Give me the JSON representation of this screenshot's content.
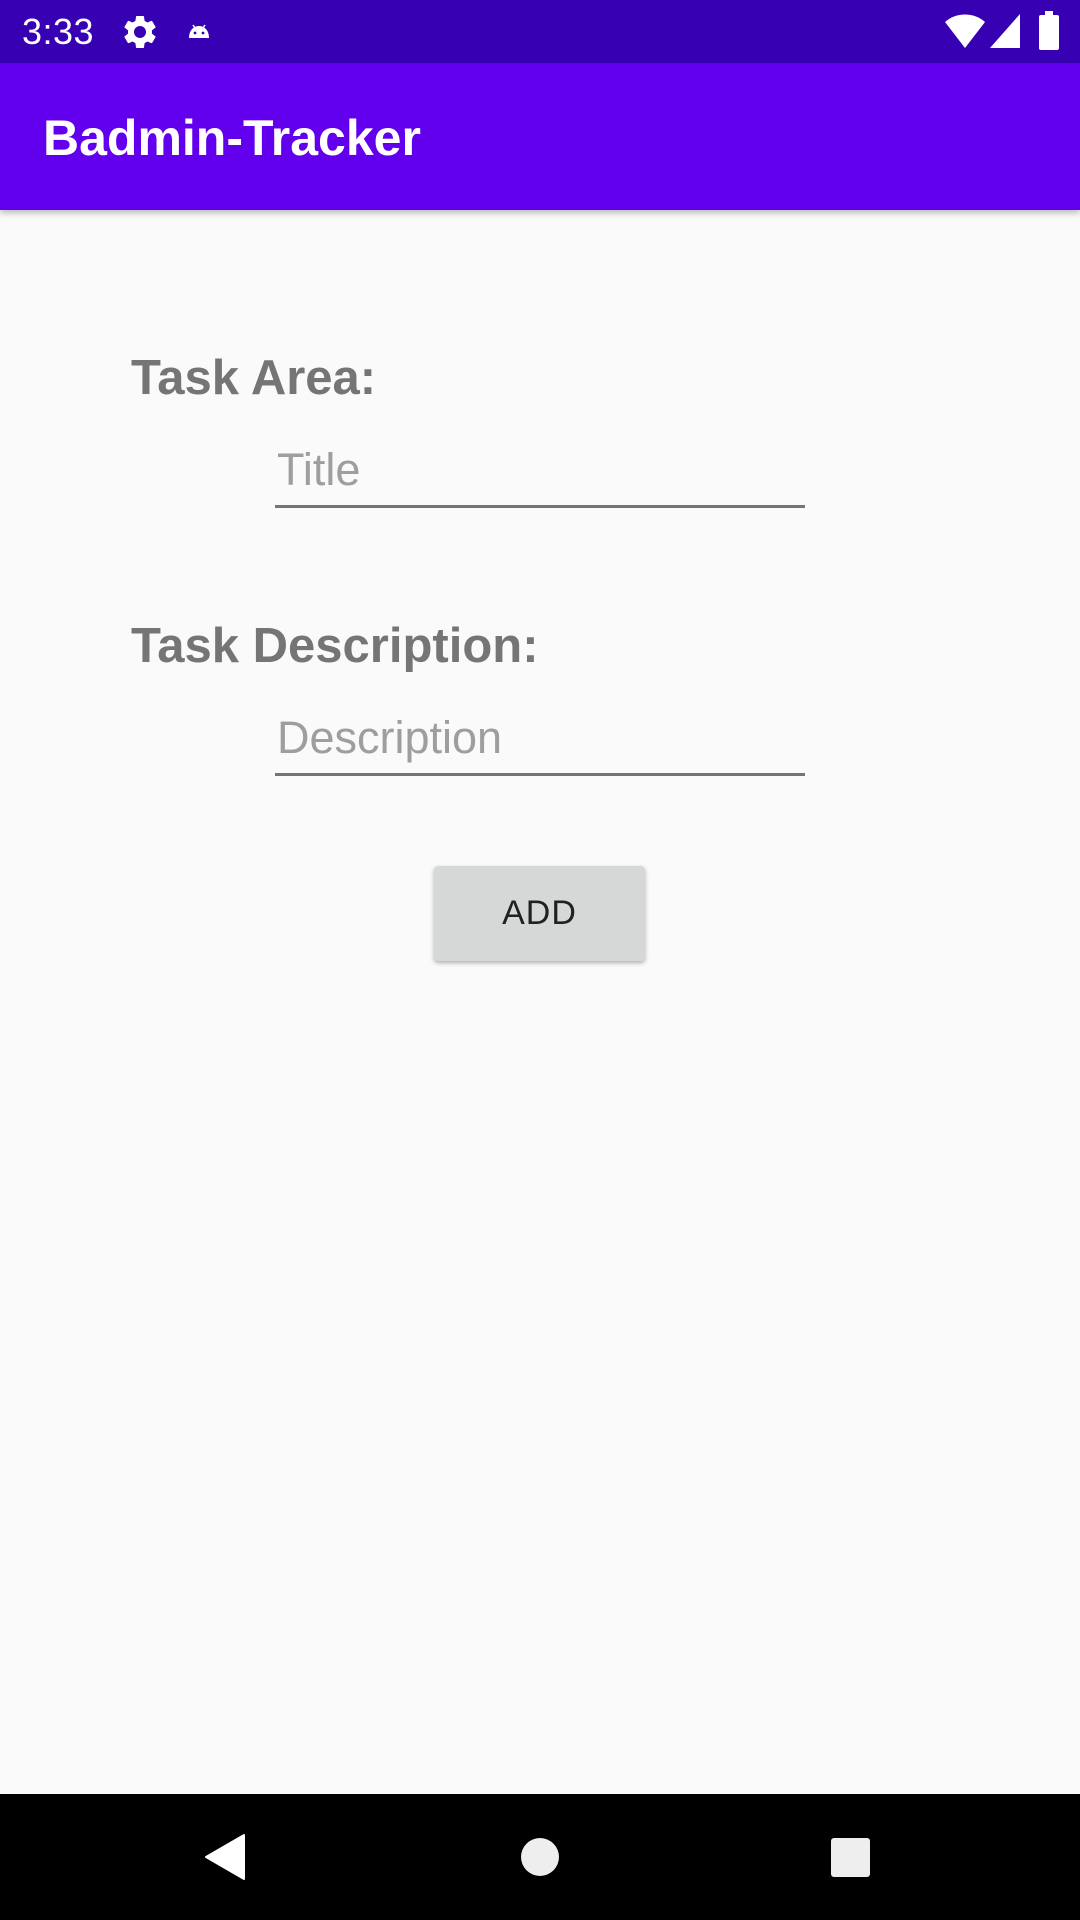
{
  "status_bar": {
    "time": "3:33",
    "icons": [
      "settings-icon",
      "android-icon",
      "wifi-icon",
      "signal-icon",
      "battery-icon"
    ]
  },
  "app_bar": {
    "title": "Badmin-Tracker"
  },
  "form": {
    "task_area_label": "Task Area:",
    "title_placeholder": "Title",
    "title_value": "",
    "task_description_label": "Task Description:",
    "description_placeholder": "Description",
    "description_value": "",
    "add_button_label": "ADD"
  },
  "nav_bar": {
    "icons": [
      "back-icon",
      "home-icon",
      "recents-icon"
    ]
  },
  "colors": {
    "status_bar": "#3700b3",
    "app_bar": "#6200ee",
    "background": "#fafafa",
    "label_text": "#757575",
    "button_bg": "#d6d7d7"
  }
}
